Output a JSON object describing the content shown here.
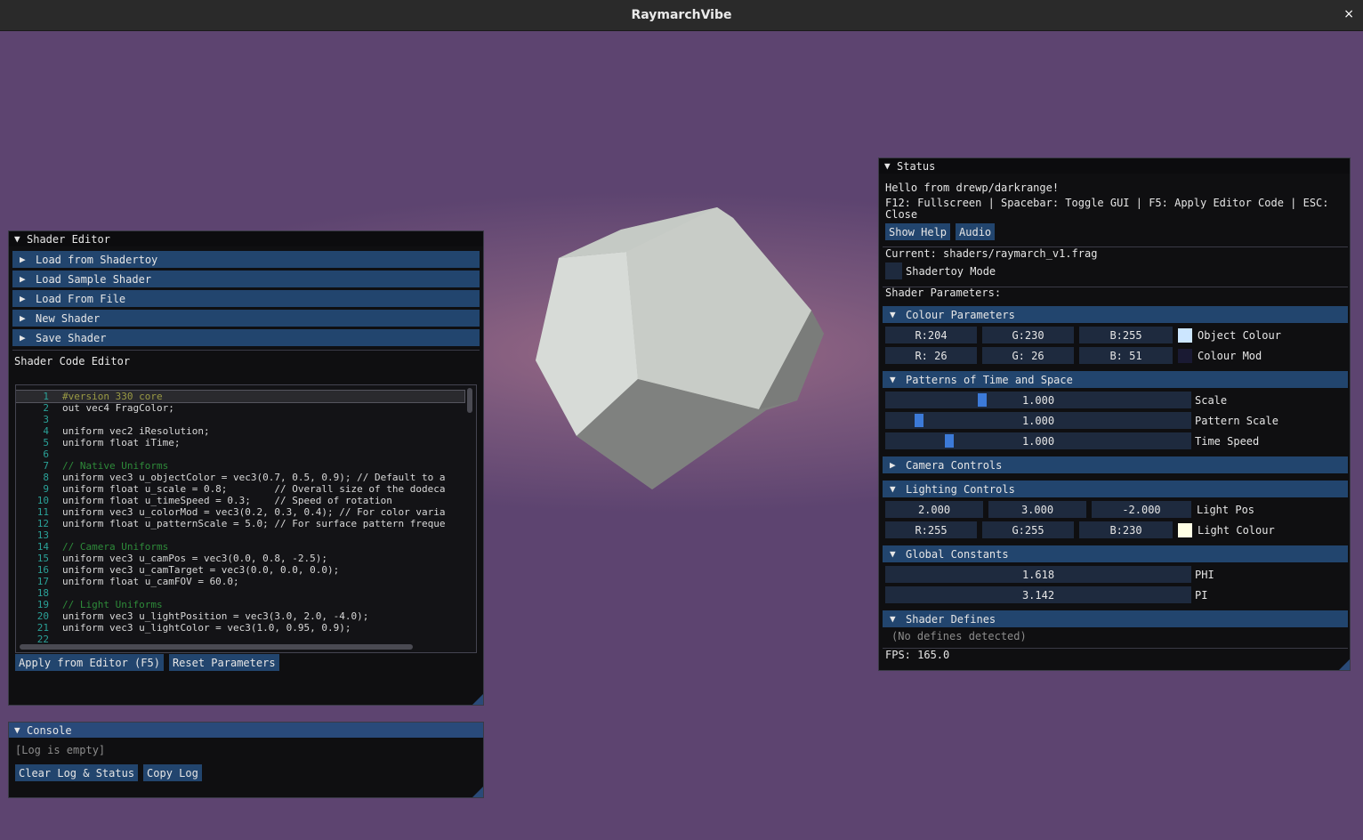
{
  "app": {
    "title": "RaymarchVibe",
    "close_glyph": "×"
  },
  "editor": {
    "title": "Shader Editor",
    "menu": [
      "Load from Shadertoy",
      "Load Sample Shader",
      "Load From File",
      "New Shader",
      "Save Shader"
    ],
    "code_editor_label": "Shader Code Editor",
    "code": [
      {
        "n": "1",
        "t": "#version 330 core"
      },
      {
        "n": "2",
        "t": "out vec4 FragColor;"
      },
      {
        "n": "3",
        "t": ""
      },
      {
        "n": "4",
        "t": "uniform vec2 iResolution;"
      },
      {
        "n": "5",
        "t": "uniform float iTime;"
      },
      {
        "n": "6",
        "t": ""
      },
      {
        "n": "7",
        "t": "// Native Uniforms"
      },
      {
        "n": "8",
        "t": "uniform vec3 u_objectColor = vec3(0.7, 0.5, 0.9); // Default to a"
      },
      {
        "n": "9",
        "t": "uniform float u_scale = 0.8;        // Overall size of the dodeca"
      },
      {
        "n": "10",
        "t": "uniform float u_timeSpeed = 0.3;    // Speed of rotation"
      },
      {
        "n": "11",
        "t": "uniform vec3 u_colorMod = vec3(0.2, 0.3, 0.4); // For color varia"
      },
      {
        "n": "12",
        "t": "uniform float u_patternScale = 5.0; // For surface pattern freque"
      },
      {
        "n": "13",
        "t": ""
      },
      {
        "n": "14",
        "t": "// Camera Uniforms"
      },
      {
        "n": "15",
        "t": "uniform vec3 u_camPos = vec3(0.0, 0.8, -2.5);"
      },
      {
        "n": "16",
        "t": "uniform vec3 u_camTarget = vec3(0.0, 0.0, 0.0);"
      },
      {
        "n": "17",
        "t": "uniform float u_camFOV = 60.0;"
      },
      {
        "n": "18",
        "t": ""
      },
      {
        "n": "19",
        "t": "// Light Uniforms"
      },
      {
        "n": "20",
        "t": "uniform vec3 u_lightPosition = vec3(3.0, 2.0, -4.0);"
      },
      {
        "n": "21",
        "t": "uniform vec3 u_lightColor = vec3(1.0, 0.95, 0.9);"
      },
      {
        "n": "22",
        "t": ""
      }
    ],
    "apply_button": "Apply from Editor (F5)",
    "reset_button": "Reset Parameters"
  },
  "console": {
    "title": "Console",
    "empty_text": "[Log is empty]",
    "clear_button": "Clear Log & Status",
    "copy_button": "Copy Log"
  },
  "status": {
    "title": "Status",
    "greeting": "Hello from drewp/darkrange!",
    "help_line1": "F12: Fullscreen | Spacebar: Toggle GUI | F5: Apply Editor Code | ESC:",
    "help_line2": "Close",
    "show_help_button": "Show Help",
    "audio_button": "Audio",
    "current": "Current: shaders/raymarch_v1.frag",
    "shadertoy_mode": "Shadertoy Mode",
    "shader_params_label": "Shader Parameters:",
    "colour_params": {
      "title": "Colour Parameters",
      "object_colour": {
        "r": "R:204",
        "g": "G:230",
        "b": "B:255",
        "label": "Object Colour",
        "swatch": "#cce6ff"
      },
      "colour_mod": {
        "r": "R: 26",
        "g": "G: 26",
        "b": "B: 51",
        "label": "Colour Mod",
        "swatch": "#1a1a33"
      }
    },
    "patterns": {
      "title": "Patterns of Time and Space",
      "scale": {
        "value": "1.000",
        "label": "Scale",
        "fraction": 0.31
      },
      "pattern_scale": {
        "value": "1.000",
        "label": "Pattern Scale",
        "fraction": 0.1
      },
      "time_speed": {
        "value": "1.000",
        "label": "Time Speed",
        "fraction": 0.2
      }
    },
    "camera": {
      "title": "Camera Controls"
    },
    "lighting": {
      "title": "Lighting Controls",
      "light_pos": {
        "x": "2.000",
        "y": "3.000",
        "z": "-2.000",
        "label": "Light Pos"
      },
      "light_colour": {
        "r": "R:255",
        "g": "G:255",
        "b": "B:230",
        "label": "Light Colour",
        "swatch": "#ffffe6"
      }
    },
    "globals": {
      "title": "Global Constants",
      "phi": {
        "value": "1.618",
        "label": "PHI"
      },
      "pi": {
        "value": "3.142",
        "label": "PI"
      }
    },
    "defines": {
      "title": "Shader Defines",
      "empty": "(No defines detected)"
    },
    "fps": "FPS: 165.0"
  }
}
